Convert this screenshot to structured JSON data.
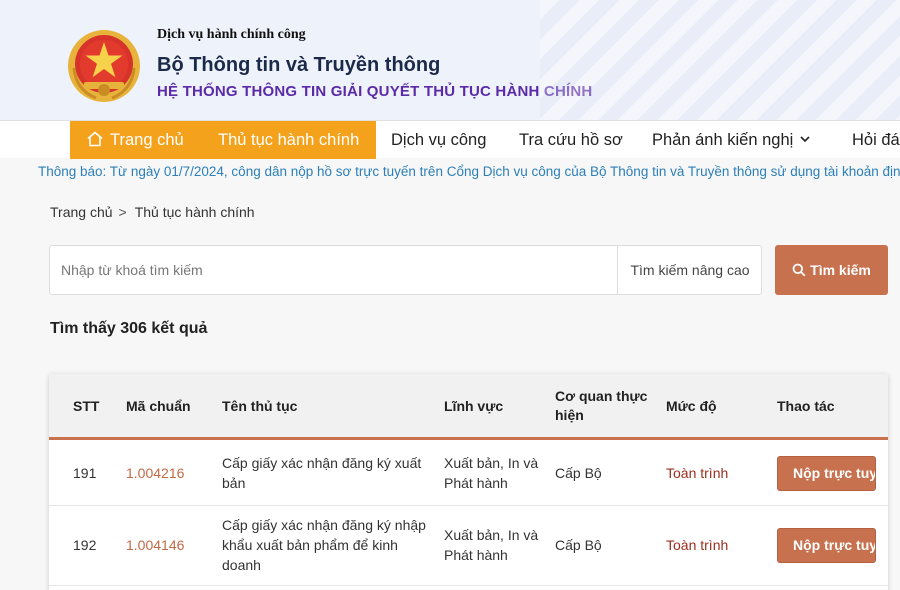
{
  "header": {
    "small_title": "Dịch vụ hành chính công",
    "title": "Bộ Thông tin và Truyền thông",
    "subtitle": "HỆ THỐNG THÔNG TIN GIẢI QUYẾT THỦ TỤC HÀNH CHÍNH",
    "emblem_icon": "national-emblem"
  },
  "nav": {
    "items": [
      {
        "label": "Trang chủ",
        "icon": "home-icon",
        "active": true
      },
      {
        "label": "Thủ tục hành chính",
        "active": true
      },
      {
        "label": "Dịch vụ công"
      },
      {
        "label": "Tra cứu hồ sơ"
      },
      {
        "label": "Phản ánh kiến nghị",
        "icon": "chevron-down-icon"
      },
      {
        "label": "Hỏi đá"
      }
    ]
  },
  "notice": "Thông báo: Từ ngày 01/7/2024, công dân nộp hồ sơ trực tuyến trên Cổng Dịch vụ công của Bộ Thông tin và Truyền thông sử dụng tài khoản định",
  "breadcrumb": {
    "home": "Trang chủ",
    "current": "Thủ tục hành chính"
  },
  "search": {
    "placeholder": "Nhập từ khoá tìm kiếm",
    "value": "",
    "advanced_label": "Tìm kiếm nâng cao",
    "button_label": "Tìm kiếm"
  },
  "result_count": "Tìm thấy 306 kết quả",
  "table": {
    "headers": {
      "stt": "STT",
      "code": "Mã chuẩn",
      "name": "Tên thủ tục",
      "field": "Lĩnh vực",
      "agency_1": "Cơ quan thực",
      "agency_2": "hiện",
      "level": "Mức độ",
      "action": "Thao tác"
    },
    "rows": [
      {
        "stt": "191",
        "code": "1.004216",
        "name_lines": [
          "Cấp giấy xác nhận đăng ký xuất",
          "bản"
        ],
        "field_lines": [
          "Xuất bản, In và",
          "Phát hành"
        ],
        "agency": "Cấp Bộ",
        "level": "Toàn trình",
        "action": "Nộp trực tuyến"
      },
      {
        "stt": "192",
        "code": "1.004146",
        "name_lines": [
          "Cấp giấy xác nhận đăng ký nhập",
          "khẩu xuất bản phẩm để kinh",
          "doanh"
        ],
        "field_lines": [
          "Xuất bản, In và",
          "Phát hành"
        ],
        "agency": "Cấp Bộ",
        "level": "Toàn trình",
        "action": "Nộp trực tuyến"
      }
    ]
  },
  "colors": {
    "nav_active": "#f4a21c",
    "accent": "#c8714f",
    "notice_text": "#2c7fb8",
    "subtitle": "#5a2aa8"
  }
}
